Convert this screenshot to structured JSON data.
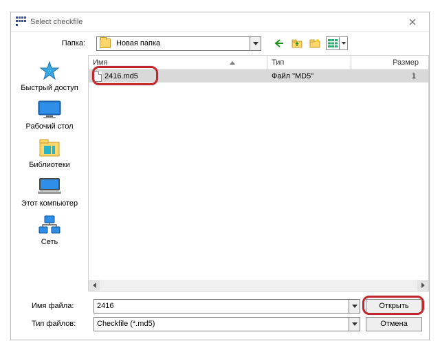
{
  "window": {
    "title": "Select checkfile"
  },
  "toolbar": {
    "folder_label": "Папка:",
    "folder_value": "Новая папка",
    "icons": {
      "back": "back-arrow-icon",
      "up": "up-folder-icon",
      "new_folder": "new-folder-icon",
      "views": "views-icon"
    }
  },
  "places": [
    {
      "key": "quick",
      "label": "Быстрый доступ"
    },
    {
      "key": "desktop",
      "label": "Рабочий стол"
    },
    {
      "key": "libs",
      "label": "Библиотеки"
    },
    {
      "key": "thispc",
      "label": "Этот компьютер"
    },
    {
      "key": "network",
      "label": "Сеть"
    }
  ],
  "columns": {
    "name": "Имя",
    "type": "Тип",
    "size": "Размер"
  },
  "rows": [
    {
      "name": "2416.md5",
      "type": "Файл \"MD5\"",
      "size": "1"
    }
  ],
  "bottom": {
    "filename_label": "Имя файла:",
    "filename_value": "2416",
    "filetype_label": "Тип файлов:",
    "filetype_value": "Checkfile (*.md5)",
    "open": "Открыть",
    "cancel": "Отмена"
  }
}
